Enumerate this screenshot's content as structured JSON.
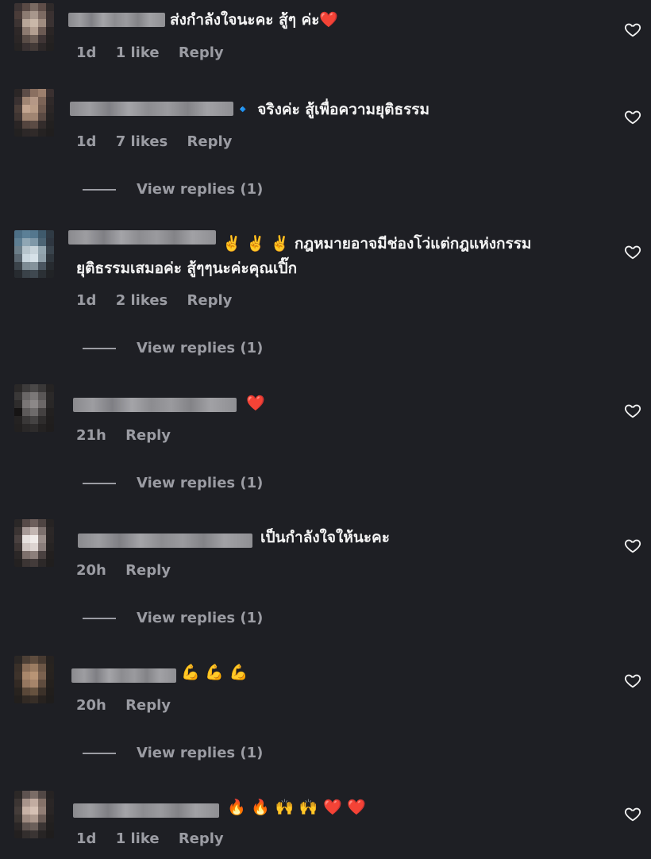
{
  "comments": [
    {
      "text": "ส่งกำลังใจนะคะ สู้ๆ ค่ะ❤️",
      "time": "1d",
      "likes": "1 like",
      "reply": "Reply",
      "view_replies": ""
    },
    {
      "text": "🔹 จริงค่ะ สู้เพื่อความยุติธรรม",
      "time": "1d",
      "likes": "7 likes",
      "reply": "Reply",
      "view_replies": "View replies (1)"
    },
    {
      "text": "✌️ ✌️ ✌️ กฎหมายอาจมีช่องโว่แต่กฎแห่งกรรม",
      "text2": "ยุติธรรมเสมอค่ะ สู้ๆๆนะค่ะคุณเปิ๊ก",
      "time": "1d",
      "likes": "2 likes",
      "reply": "Reply",
      "view_replies": "View replies (1)"
    },
    {
      "text": "❤️",
      "time": "21h",
      "likes": "",
      "reply": "Reply",
      "view_replies": "View replies (1)"
    },
    {
      "text": "เป็นกำลังใจให้นะคะ",
      "time": "20h",
      "likes": "",
      "reply": "Reply",
      "view_replies": "View replies (1)"
    },
    {
      "text": "💪 💪 💪",
      "time": "20h",
      "likes": "",
      "reply": "Reply",
      "view_replies": "View replies (1)"
    },
    {
      "text": "🔥 🔥 🙌 🙌 ❤️ ❤️",
      "time": "1d",
      "likes": "1 like",
      "reply": "Reply",
      "view_replies": ""
    }
  ],
  "icons": {
    "like": "heart-outline-icon"
  },
  "colors": {
    "background": "#1e1f24",
    "text": "#f4f4f4",
    "muted": "#9b9ca3"
  }
}
